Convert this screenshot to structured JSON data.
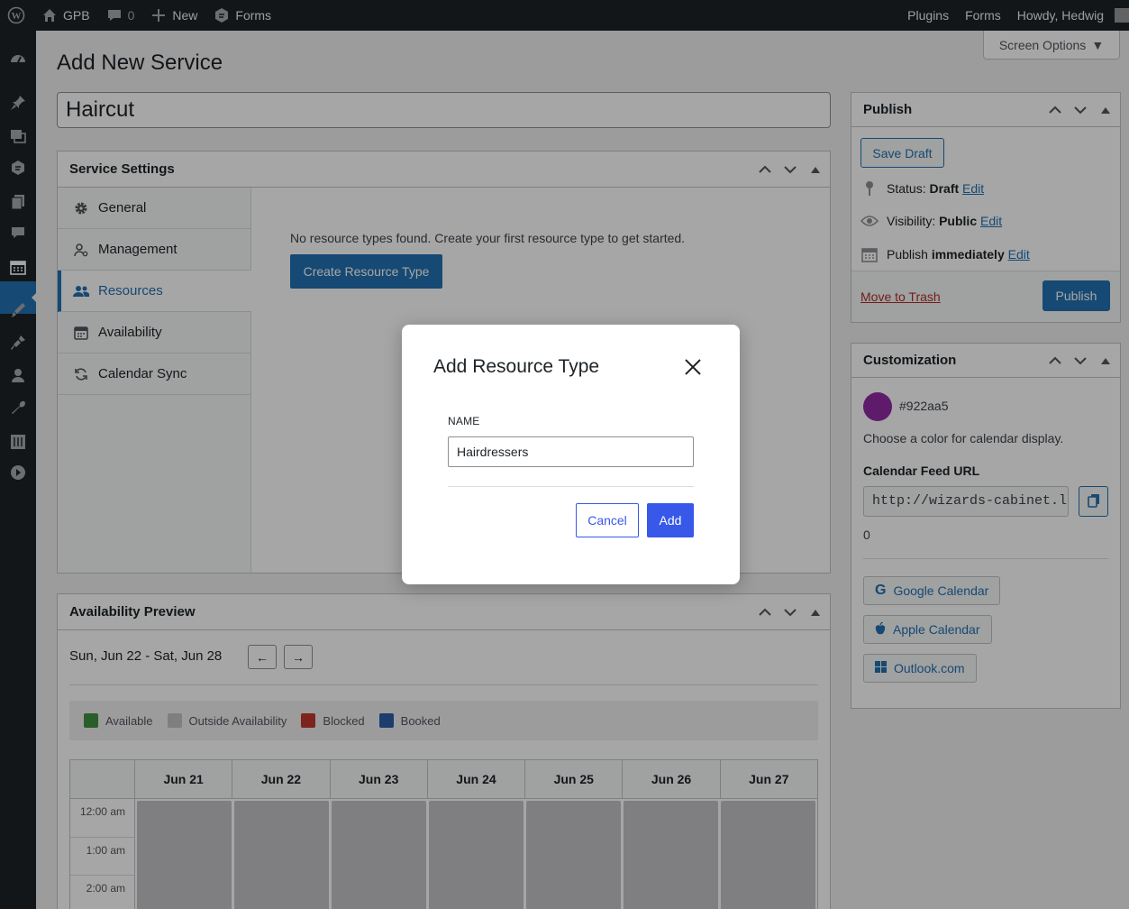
{
  "adminbar": {
    "site_name": "GPB",
    "comments_count": "0",
    "new_label": "New",
    "forms_label": "Forms",
    "right_plugins": "Plugins",
    "right_forms": "Forms",
    "howdy": "Howdy, Hedwig"
  },
  "screen_options": "Screen Options",
  "page_title": "Add New Service",
  "post_title_value": "Haircut",
  "service_settings": {
    "title": "Service Settings",
    "tabs": [
      {
        "label": "General",
        "icon": "gear-icon"
      },
      {
        "label": "Management",
        "icon": "person-gear-icon"
      },
      {
        "label": "Resources",
        "icon": "people-icon"
      },
      {
        "label": "Availability",
        "icon": "calendar-icon"
      },
      {
        "label": "Calendar Sync",
        "icon": "sync-icon"
      }
    ],
    "active_tab": "Resources",
    "empty_message": "No resource types found. Create your first resource type to get started.",
    "create_button": "Create Resource Type"
  },
  "availability_preview": {
    "title": "Availability Preview",
    "week_range": "Sun, Jun 22 - Sat, Jun 28",
    "prev_label": "←",
    "next_label": "→",
    "legend": [
      {
        "label": "Available",
        "color": "#3f9142"
      },
      {
        "label": "Outside Availability",
        "color": "#c3c4c7"
      },
      {
        "label": "Blocked",
        "color": "#c0392b"
      },
      {
        "label": "Booked",
        "color": "#2c5fa8"
      }
    ],
    "days": [
      "Jun 21",
      "Jun 22",
      "Jun 23",
      "Jun 24",
      "Jun 25",
      "Jun 26",
      "Jun 27"
    ],
    "times": [
      "12:00 am",
      "1:00 am",
      "2:00 am"
    ]
  },
  "publish": {
    "title": "Publish",
    "save_draft": "Save Draft",
    "status_label": "Status:",
    "status_value": "Draft",
    "visibility_label": "Visibility:",
    "visibility_value": "Public",
    "publish_label": "Publish",
    "publish_value": "immediately",
    "edit": "Edit",
    "move_to_trash": "Move to Trash",
    "publish_button": "Publish"
  },
  "customization": {
    "title": "Customization",
    "color_hex": "#922aa5",
    "color_help": "Choose a color for calendar display.",
    "feed_label": "Calendar Feed URL",
    "feed_url": "http://wizards-cabinet.local/",
    "feed_count": "0",
    "google": "Google Calendar",
    "apple": "Apple Calendar",
    "outlook": "Outlook.com"
  },
  "modal": {
    "title": "Add Resource Type",
    "name_label": "NAME",
    "name_value": "Hairdressers",
    "cancel": "Cancel",
    "add": "Add"
  },
  "colors": {
    "admin_blue": "#2271b1",
    "modal_blue": "#3858e9"
  }
}
